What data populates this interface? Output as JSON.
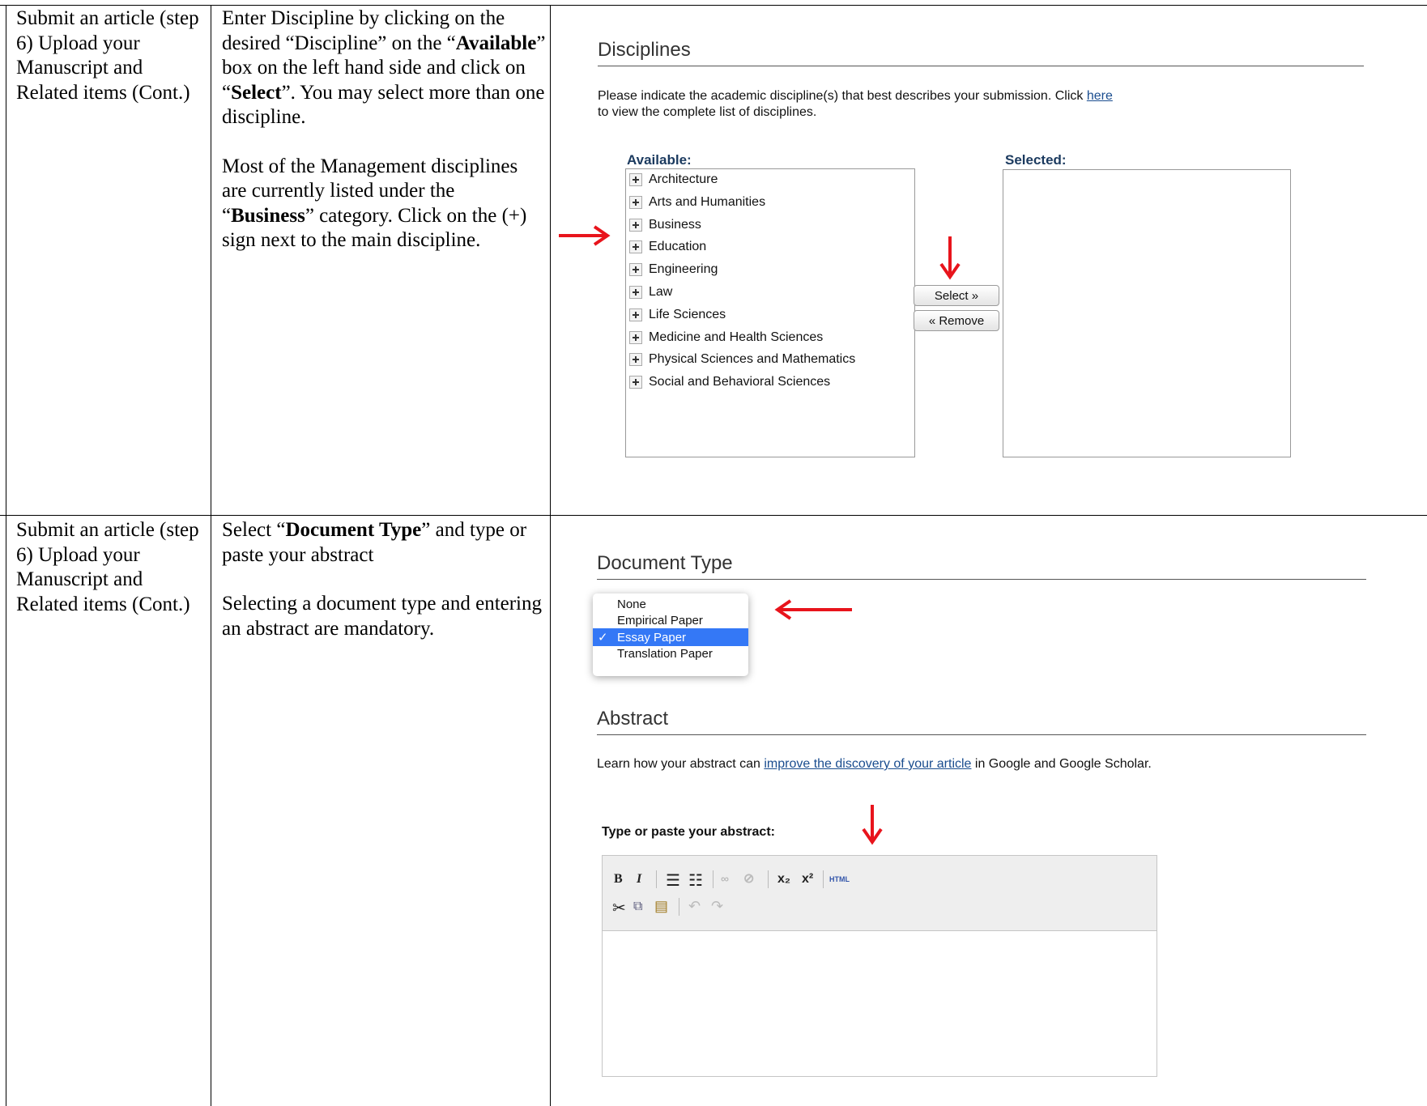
{
  "row1": {
    "col1": "Submit an article (step 6) Upload your Manuscript and Related items (Cont.)",
    "col2": {
      "p1_a": "Enter Discipline by clicking on the desired “Discipline” on the “",
      "p1_b1": "Available",
      "p1_c": "” box on the left hand side and click on “",
      "p1_b2": "Select",
      "p1_d": "”.  You may select more than one discipline.",
      "p2_a": "Most of the Management disciplines are currently listed under the “",
      "p2_b": "Business",
      "p2_c": "” category. Click on the (+) sign next to the main discipline."
    },
    "screenshot": {
      "title": "Disciplines",
      "intro_a": "Please indicate the academic discipline(s) that best describes your submission. Click ",
      "intro_link": "here",
      "intro_b": "to view the complete list of disciplines.",
      "available_label": "Available:",
      "selected_label": "Selected:",
      "disciplines": [
        "Architecture",
        "Arts and Humanities",
        "Business",
        "Education",
        "Engineering",
        "Law",
        "Life Sciences",
        "Medicine and Health Sciences",
        "Physical Sciences and Mathematics",
        "Social and Behavioral Sciences"
      ],
      "select_btn": "Select »",
      "remove_btn": "« Remove"
    }
  },
  "row2": {
    "col1": "Submit an article (step 6) Upload your Manuscript and Related items (Cont.)",
    "col2": {
      "p1_a": "Select “",
      "p1_b": "Document Type",
      "p1_c": "” and type or paste your abstract",
      "p2": "Selecting a document type and entering an abstract are mandatory."
    },
    "screenshot": {
      "doc_title": "Document Type",
      "options": [
        "None",
        "Empirical Paper",
        "Essay Paper",
        "Translation Paper"
      ],
      "selected_option": "Essay Paper",
      "check": "✓",
      "abstract_title": "Abstract",
      "abstract_a": "Learn how your abstract can ",
      "abstract_link": "improve the discovery of your article",
      "abstract_b": " in Google and Google Scholar.",
      "editor_label": "Type or paste your abstract:",
      "toolbar": {
        "bold": "B",
        "italic": "I",
        "sub": "x₂",
        "sup": "x²",
        "html": "HTML"
      }
    }
  },
  "colors": {
    "arrow": "#e8141c",
    "link": "#1a4d8f",
    "highlight": "#3478f6"
  }
}
